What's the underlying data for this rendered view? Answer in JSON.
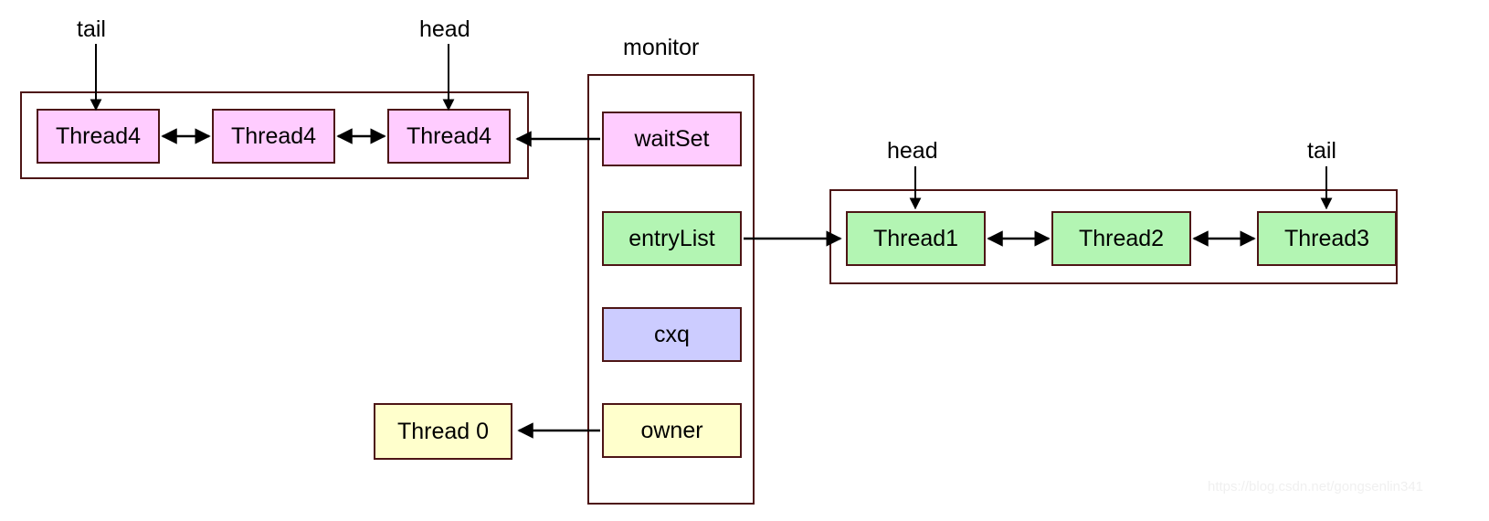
{
  "diagram": {
    "title_label": "monitor",
    "watermark": "https://blog.csdn.net/gongsenlin341",
    "colors": {
      "pink": "#ffccff",
      "green": "#b3f5b3",
      "purple": "#ccccff",
      "yellow": "#ffffcc",
      "stroke": "#4d1515",
      "arrow": "#000000",
      "background": "#ffffff"
    }
  },
  "wait_set_list": {
    "tail_label": "tail",
    "head_label": "head",
    "nodes": [
      {
        "label": "Thread4"
      },
      {
        "label": "Thread4"
      },
      {
        "label": "Thread4"
      }
    ]
  },
  "monitor": {
    "label": "monitor",
    "fields": [
      {
        "name": "waitSet",
        "label": "waitSet",
        "color": "pink"
      },
      {
        "name": "entryList",
        "label": "entryList",
        "color": "green"
      },
      {
        "name": "cxq",
        "label": "cxq",
        "color": "purple"
      },
      {
        "name": "owner",
        "label": "owner",
        "color": "yellow"
      }
    ]
  },
  "owner_thread": {
    "label": "Thread 0"
  },
  "entry_list_queue": {
    "head_label": "head",
    "tail_label": "tail",
    "nodes": [
      {
        "label": "Thread1"
      },
      {
        "label": "Thread2"
      },
      {
        "label": "Thread3"
      }
    ]
  }
}
